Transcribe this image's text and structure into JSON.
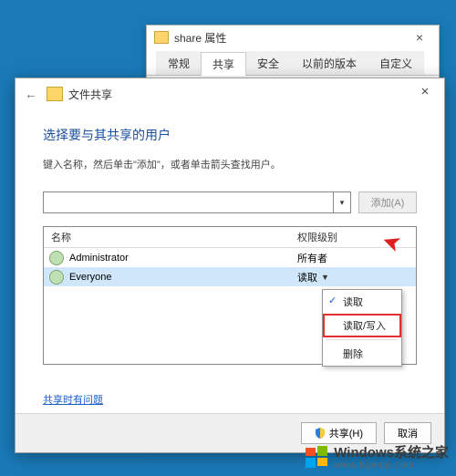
{
  "bg_window": {
    "title": "share 属性",
    "tabs": [
      "常规",
      "共享",
      "安全",
      "以前的版本",
      "自定义"
    ],
    "active_tab_index": 1
  },
  "fg_window": {
    "title": "文件共享",
    "heading": "选择要与其共享的用户",
    "subtext": "键入名称，然后单击\"添加\"，或者单击箭头查找用户。",
    "add_button": "添加(A)",
    "columns": {
      "name": "名称",
      "perm": "权限级别"
    },
    "rows": [
      {
        "name": "Administrator",
        "perm": "所有者"
      },
      {
        "name": "Everyone",
        "perm": "读取",
        "selected": true,
        "has_dropdown": true
      }
    ],
    "perm_menu": {
      "items": [
        "读取",
        "读取/写入",
        "删除"
      ],
      "checked_index": 0,
      "highlight_index": 1
    },
    "help_link": "共享时有问题",
    "buttons": {
      "share": "共享(H)",
      "cancel": "取消"
    }
  },
  "watermark": {
    "brand": "Windows",
    "tagline": "系统之家",
    "url": "www.bjjmcp.com"
  }
}
